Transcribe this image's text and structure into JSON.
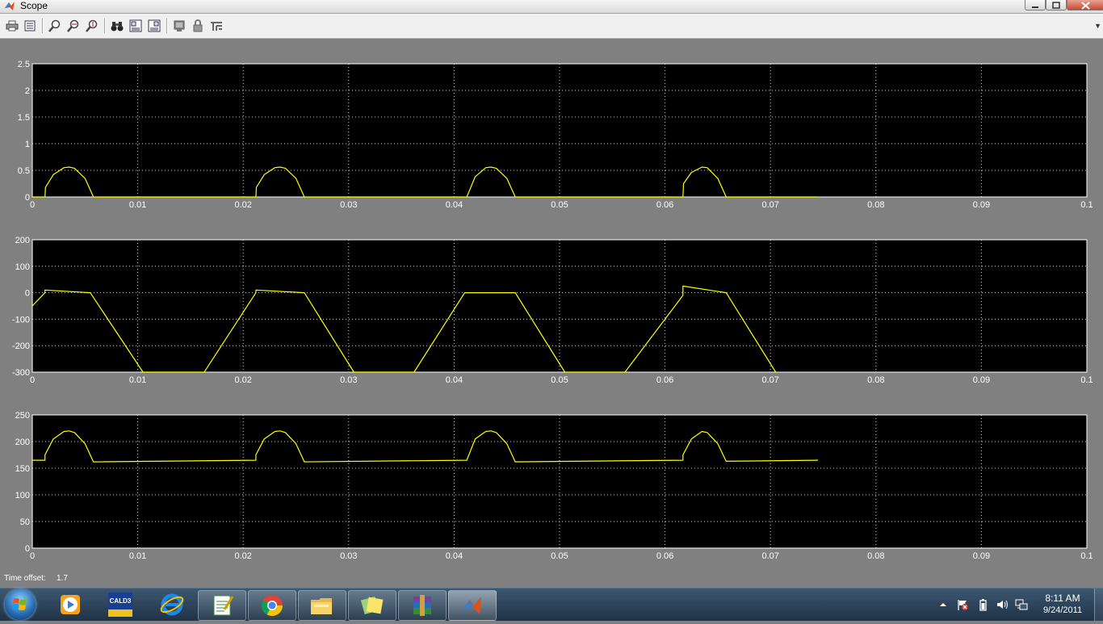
{
  "window": {
    "title": "Scope",
    "controls": [
      "minimize-icon",
      "maximize-icon",
      "close-icon"
    ]
  },
  "toolbar": {
    "buttons": [
      {
        "name": "print-button",
        "icon": "printer-icon"
      },
      {
        "name": "parameters-button",
        "icon": "parameters-icon"
      },
      {
        "name": "zoom-button",
        "icon": "zoom-icon"
      },
      {
        "name": "zoom-x-button",
        "icon": "zoom-x-icon"
      },
      {
        "name": "zoom-y-button",
        "icon": "zoom-y-icon"
      },
      {
        "name": "autoscale-button",
        "icon": "binoculars-icon"
      },
      {
        "name": "save-axes-button",
        "icon": "save-axes-icon"
      },
      {
        "name": "restore-axes-button",
        "icon": "restore-axes-icon"
      },
      {
        "name": "floating-scope-button",
        "icon": "floating-scope-icon"
      },
      {
        "name": "lock-axes-button",
        "icon": "lock-icon"
      },
      {
        "name": "signal-selection-button",
        "icon": "signal-selection-icon"
      }
    ]
  },
  "colors": {
    "plot_background": "#000000",
    "figure_background": "#808080",
    "trace": "#ffff00",
    "grid": "#ffffff"
  },
  "status": {
    "time_offset_label": "Time offset:",
    "time_offset_value": "1.7"
  },
  "chart_data": [
    {
      "type": "line",
      "xlim": [
        0,
        0.1
      ],
      "ylim": [
        0,
        2.5
      ],
      "xticks": [
        "0",
        "0.01",
        "0.02",
        "0.03",
        "0.04",
        "0.05",
        "0.06",
        "0.07",
        "0.08",
        "0.09",
        "0.1"
      ],
      "yticks": [
        "0",
        "0.5",
        "1",
        "1.5",
        "2",
        "2.5"
      ],
      "grid": true,
      "series": [
        {
          "color": "#ffff00",
          "x": [
            0,
            0.0012,
            0.00125,
            0.002,
            0.003,
            0.0035,
            0.004,
            0.005,
            0.0058,
            0.0212,
            0.02125,
            0.022,
            0.023,
            0.0235,
            0.024,
            0.025,
            0.0258,
            0.0412,
            0.042,
            0.043,
            0.0435,
            0.044,
            0.045,
            0.0458,
            0.0617,
            0.06175,
            0.0625,
            0.0635,
            0.064,
            0.065,
            0.0658,
            0.0745
          ],
          "y": [
            0,
            0,
            0.18,
            0.42,
            0.55,
            0.56,
            0.54,
            0.35,
            0,
            0,
            0.18,
            0.42,
            0.55,
            0.56,
            0.54,
            0.35,
            0,
            0,
            0.38,
            0.55,
            0.56,
            0.54,
            0.35,
            0,
            0,
            0.25,
            0.46,
            0.56,
            0.55,
            0.35,
            0,
            0
          ]
        }
      ]
    },
    {
      "type": "line",
      "xlim": [
        0,
        0.1
      ],
      "ylim": [
        -300,
        200
      ],
      "xticks": [
        "0",
        "0.01",
        "0.02",
        "0.03",
        "0.04",
        "0.05",
        "0.06",
        "0.07",
        "0.08",
        "0.09",
        "0.1"
      ],
      "yticks": [
        "-300",
        "-200",
        "-100",
        "0",
        "100",
        "200"
      ],
      "grid": true,
      "series": [
        {
          "color": "#ffff00",
          "x": [
            0,
            0.0012,
            0.0012,
            0.0055,
            0.0105,
            0.0163,
            0.0212,
            0.0212,
            0.0258,
            0.0305,
            0.0362,
            0.041,
            0.0458,
            0.0505,
            0.0562,
            0.0617,
            0.0617,
            0.0658,
            0.0705
          ],
          "y": [
            -50,
            0,
            10,
            0,
            -300,
            -300,
            0,
            10,
            0,
            -300,
            -300,
            0,
            0,
            -300,
            -300,
            -10,
            25,
            0,
            -300
          ]
        }
      ]
    },
    {
      "type": "line",
      "xlim": [
        0,
        0.1
      ],
      "ylim": [
        0,
        250
      ],
      "xticks": [
        "0",
        "0.01",
        "0.02",
        "0.03",
        "0.04",
        "0.05",
        "0.06",
        "0.07",
        "0.08",
        "0.09",
        "0.1"
      ],
      "yticks": [
        "0",
        "50",
        "100",
        "150",
        "200",
        "250"
      ],
      "grid": true,
      "series": [
        {
          "color": "#ffff00",
          "x": [
            0,
            0.0012,
            0.0012,
            0.002,
            0.003,
            0.0035,
            0.004,
            0.005,
            0.0058,
            0.0212,
            0.0212,
            0.022,
            0.023,
            0.0235,
            0.024,
            0.025,
            0.0258,
            0.0412,
            0.042,
            0.043,
            0.0435,
            0.044,
            0.045,
            0.0458,
            0.0617,
            0.0617,
            0.0625,
            0.0635,
            0.064,
            0.065,
            0.0658,
            0.0745
          ],
          "y": [
            165,
            165,
            175,
            205,
            219,
            220,
            217,
            196,
            162,
            165,
            175,
            205,
            219,
            220,
            217,
            196,
            162,
            165,
            205,
            219,
            220,
            217,
            196,
            162,
            165,
            175,
            205,
            219,
            217,
            196,
            163,
            165
          ]
        }
      ]
    }
  ],
  "taskbar": {
    "start": "windows-start-icon",
    "items": [
      {
        "name": "taskbar-media-player",
        "icon": "media-player-icon"
      },
      {
        "name": "taskbar-cald3",
        "icon": "cald3-icon",
        "label": "CALD3"
      },
      {
        "name": "taskbar-internet-explorer",
        "icon": "internet-explorer-icon"
      },
      {
        "name": "taskbar-notepad",
        "icon": "notepad-icon"
      },
      {
        "name": "taskbar-chrome",
        "icon": "chrome-icon"
      },
      {
        "name": "taskbar-explorer",
        "icon": "folder-icon"
      },
      {
        "name": "taskbar-sticky-notes",
        "icon": "sticky-notes-icon"
      },
      {
        "name": "taskbar-winrar",
        "icon": "winrar-icon"
      },
      {
        "name": "taskbar-matlab",
        "icon": "matlab-icon"
      }
    ],
    "tray": {
      "icons": [
        "show-hidden-icons-icon",
        "action-center-flag-icon",
        "battery-icon",
        "volume-icon",
        "network-icon"
      ],
      "time": "8:11 AM",
      "date": "9/24/2011"
    }
  }
}
